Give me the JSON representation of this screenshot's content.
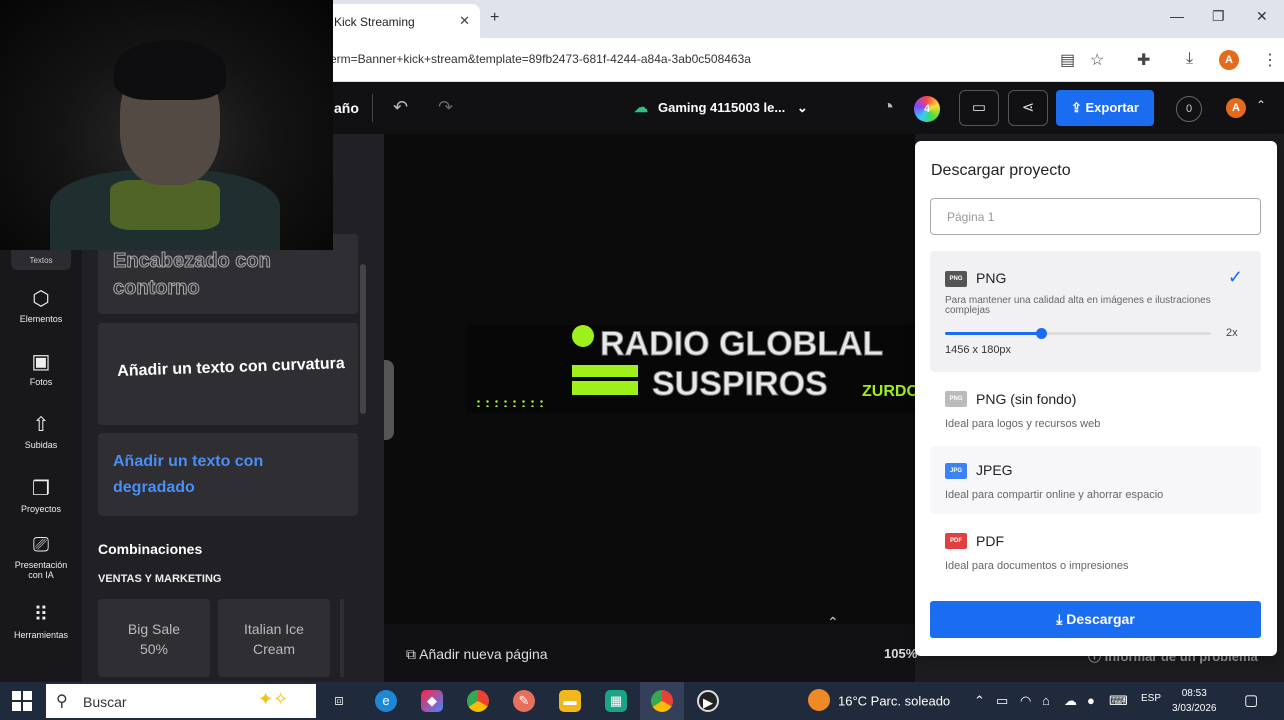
{
  "browser": {
    "tab_title": "Kick Streaming",
    "tab_close": "✕",
    "new_tab": "+",
    "url": "erm=Banner+kick+stream&template=89fb2473-681f-4244-a84a-3ab0c508463a",
    "profile_initial": "A",
    "window_controls": [
      "—",
      "❐",
      "✕"
    ]
  },
  "app": {
    "size_label": "año",
    "project_name": "Gaming 4115003 le...",
    "colors_badge": "4",
    "export_label": "Exportar",
    "notifications_count": "0",
    "user_initial": "A"
  },
  "leftnav": {
    "items": [
      {
        "label": "Textos",
        "icon": "text-icon"
      },
      {
        "label": "Elementos",
        "icon": "shapes-icon"
      },
      {
        "label": "Fotos",
        "icon": "image-icon"
      },
      {
        "label": "Subidas",
        "icon": "upload-icon"
      },
      {
        "label": "Proyectos",
        "icon": "folder-icon"
      },
      {
        "label": "Presentación con IA",
        "icon": "presentation-icon"
      },
      {
        "label": "Herramientas",
        "icon": "grid-icon"
      }
    ]
  },
  "panel": {
    "card_outline": "Encabezado con contorno",
    "card_curve": "Añadir un texto con curvatura",
    "card_gradient": "Añadir un texto con degradado",
    "combinations_title": "Combinaciones",
    "section_title": "VENTAS Y MARKETING",
    "combos": [
      "Big Sale 50%",
      "Italian Ice Cream"
    ]
  },
  "canvas": {
    "banner_line1": "RADIO GLOBLAL",
    "banner_line2": "SUSPIROS",
    "banner_tag": "ZURDO",
    "add_page": "Añadir nueva página",
    "zoom": "105%",
    "accent_green": "#9ef01a"
  },
  "download": {
    "title": "Descargar proyecto",
    "page_select": "Página 1",
    "options": [
      {
        "name": "PNG",
        "desc": "Para mantener una calidad alta en imágenes e ilustraciones complejas",
        "icon": "PNG",
        "selected": true
      },
      {
        "name": "PNG (sin fondo)",
        "desc": "Ideal para logos y recursos web",
        "icon": "PNG",
        "selected": false
      },
      {
        "name": "JPEG",
        "desc": "Ideal para compartir online y ahorrar espacio",
        "icon": "JPG",
        "selected": false
      },
      {
        "name": "PDF",
        "desc": "Ideal para documentos o impresiones",
        "icon": "PDF",
        "selected": false
      }
    ],
    "scale_value": 0.36,
    "scale_max_label": "2x",
    "dimensions": "1456 x 180px",
    "button": "Descargar",
    "report": "Informar de un problema",
    "accent": "#1a6cf0"
  },
  "taskbar": {
    "search_placeholder": "Buscar",
    "weather": "16°C  Parc. soleado",
    "language": "ESP",
    "time": "08:53",
    "date": "3/03/2026"
  }
}
